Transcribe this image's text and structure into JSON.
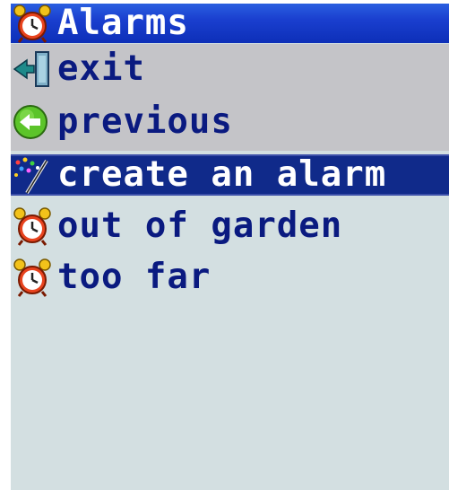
{
  "window": {
    "title": "Alarms",
    "title_icon": "alarm-clock-icon"
  },
  "menu": {
    "exit_label": "exit",
    "exit_icon": "exit-door-icon",
    "previous_label": "previous",
    "previous_icon": "back-arrow-icon",
    "create_label": "create an alarm",
    "create_icon": "magic-wand-icon"
  },
  "alarms": [
    {
      "label": "out of garden",
      "icon": "alarm-clock-icon"
    },
    {
      "label": "too far",
      "icon": "alarm-clock-icon"
    }
  ],
  "colors": {
    "title_bar": "#1a3fcf",
    "selected_row": "#102a8a",
    "menu_grey": "#c4c4c8",
    "background": "#d3dfe1",
    "text_dark_blue": "#0a1a80"
  }
}
